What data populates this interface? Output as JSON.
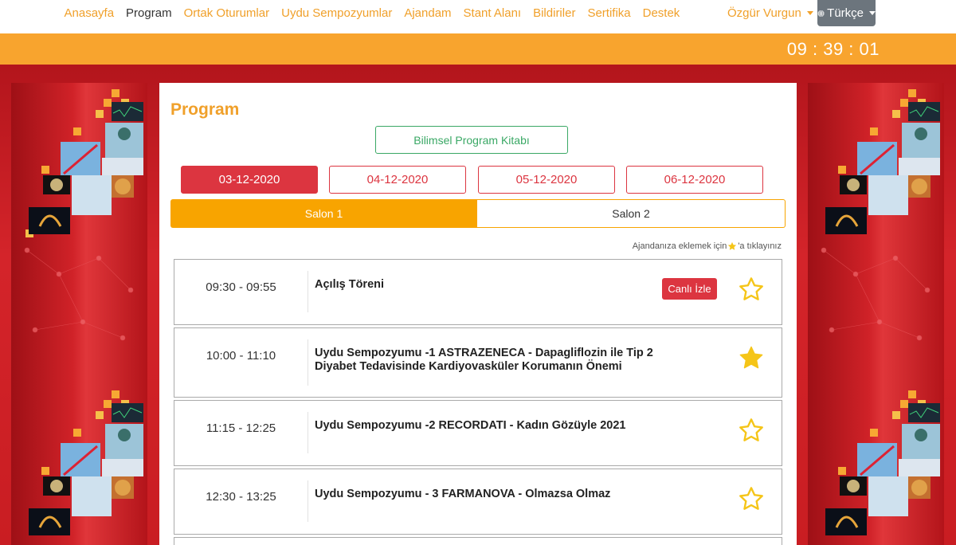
{
  "nav": {
    "links": [
      {
        "label": "Anasayfa",
        "active": false
      },
      {
        "label": "Program",
        "active": true
      },
      {
        "label": "Ortak Oturumlar",
        "active": false
      },
      {
        "label": "Uydu Sempozyumlar",
        "active": false
      },
      {
        "label": "Ajandam",
        "active": false
      },
      {
        "label": "Stant Alanı",
        "active": false
      },
      {
        "label": "Bildiriler",
        "active": false
      },
      {
        "label": "Sertifika",
        "active": false
      },
      {
        "label": "Destek",
        "active": false
      }
    ],
    "user_name": "Özgür Vurgun",
    "language": "Türkçe"
  },
  "clock": "09 : 39 : 01",
  "program": {
    "title": "Program",
    "book_button": "Bilimsel Program Kitabı",
    "dates": [
      "03-12-2020",
      "04-12-2020",
      "05-12-2020",
      "06-12-2020"
    ],
    "active_date_index": 0,
    "salons": [
      "Salon 1",
      "Salon 2"
    ],
    "active_salon_index": 0,
    "hint_before": "Ajandanıza eklemek için",
    "hint_after": "'a tıklayınız",
    "sessions": [
      {
        "time": "09:30 - 09:55",
        "title": "Açılış Töreni",
        "live_label": "Canlı İzle",
        "starred": false
      },
      {
        "time": "10:00 - 11:10",
        "title": "Uydu Sempozyumu -1 ASTRAZENECA - Dapagliflozin ile Tip 2 Diyabet Tedavisinde Kardiyovasküler Korumanın Önemi",
        "live_label": "",
        "starred": true
      },
      {
        "time": "11:15 - 12:25",
        "title": "Uydu Sempozyumu -2 RECORDATI - Kadın Gözüyle 2021",
        "live_label": "",
        "starred": false
      },
      {
        "time": "12:30 - 13:25",
        "title": "Uydu Sempozyumu - 3 FARMANOVA - Olmazsa Olmaz",
        "live_label": "",
        "starred": false
      }
    ]
  },
  "colors": {
    "accent_orange": "#f0a02a",
    "bar_orange": "#f8a42e",
    "primary_red": "#dc3540",
    "book_green": "#3aa865",
    "star_gold": "#f5c518",
    "background_red": "#c81e22"
  },
  "icons": {
    "star": "star-icon",
    "star_filled": "star-filled-icon",
    "globe": "globe-icon",
    "caret": "chevron-down-icon"
  }
}
